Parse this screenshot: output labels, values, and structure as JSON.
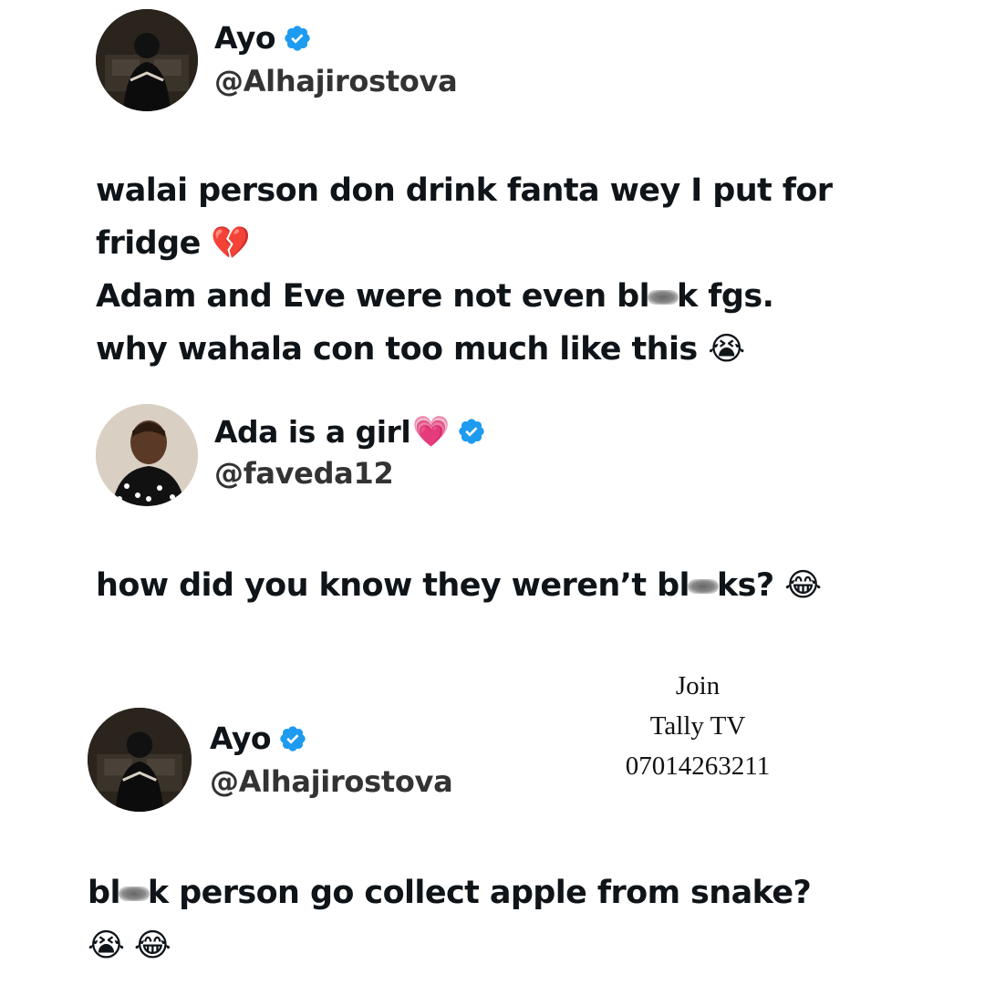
{
  "tweets": [
    {
      "name": "Ayo",
      "handle": "@Alhajirostova",
      "verified": true,
      "avatar_icon": "man-sitting-office-avatar",
      "lines": [
        {
          "pre": "walai person don drink fanta wey I put for",
          "post": "",
          "emoji": ""
        },
        {
          "pre": "fridge",
          "post": "",
          "emoji": "💔"
        },
        {
          "pre": "Adam and Eve were not even bl",
          "post": "k fgs.",
          "emoji": "",
          "censored": true
        },
        {
          "pre": "why wahala con too much like this",
          "post": "",
          "emoji": "😭"
        }
      ]
    },
    {
      "name": "Ada is a girl",
      "name_emoji": "💗",
      "handle": "@faveda12",
      "verified": true,
      "avatar_icon": "woman-polka-dot-avatar",
      "lines": [
        {
          "pre": "how did you know they weren’t bl",
          "post": "ks?",
          "emoji": "😂",
          "censored": true
        }
      ]
    },
    {
      "name": "Ayo",
      "handle": "@Alhajirostova",
      "verified": true,
      "avatar_icon": "man-sitting-office-avatar",
      "lines": [
        {
          "pre": "bl",
          "post": "k person go collect apple from snake?",
          "emoji": "",
          "censored": true
        },
        {
          "pre": "",
          "post": "",
          "emoji": "😭 😂"
        }
      ]
    }
  ],
  "overlay": {
    "line1": "Join",
    "line2": "Tally TV",
    "line3": "07014263211"
  },
  "colors": {
    "verified_badge": "#1d9bf0",
    "text": "#0f1419"
  }
}
